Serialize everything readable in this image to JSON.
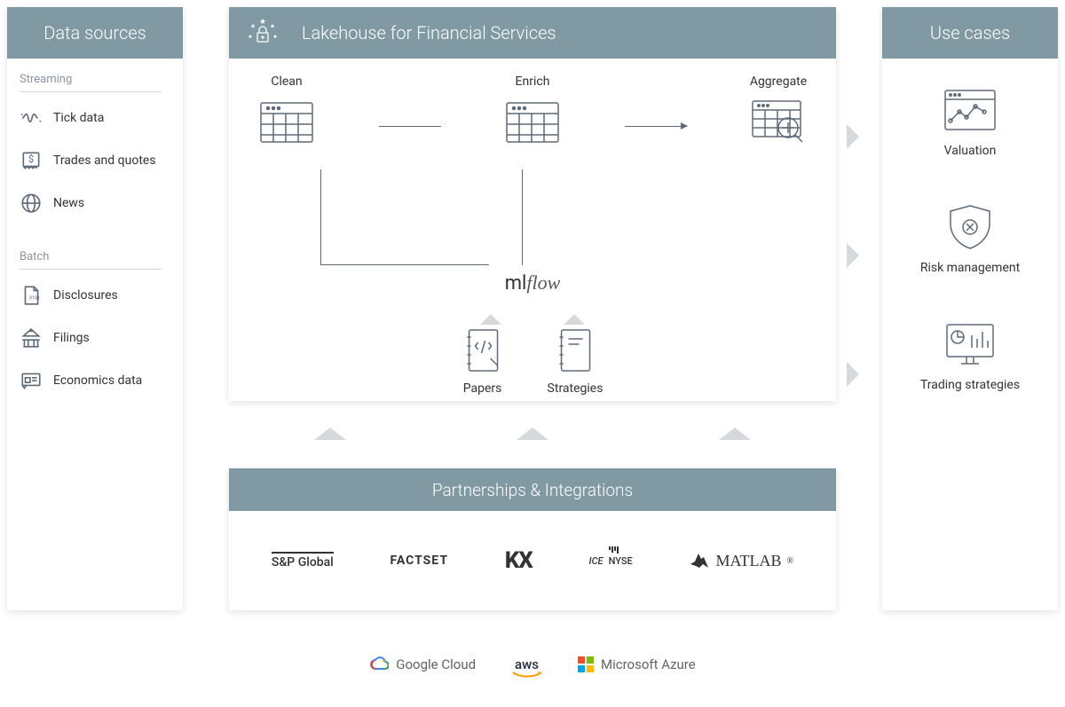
{
  "data_sources": {
    "title": "Data sources",
    "streaming": {
      "title": "Streaming",
      "items": [
        "Tick data",
        "Trades and quotes",
        "News"
      ]
    },
    "batch": {
      "title": "Batch",
      "items": [
        "Disclosures",
        "Filings",
        "Economics data"
      ]
    }
  },
  "lakehouse": {
    "title": "Lakehouse for Financial Services",
    "stages": [
      "Clean",
      "Enrich",
      "Aggregate"
    ],
    "orchestrator_a": "ml",
    "orchestrator_b": "flow",
    "docs": [
      "Papers",
      "Strategies"
    ]
  },
  "partnerships": {
    "title": "Partnerships & Integrations",
    "logos": [
      "S&P Global",
      "FACTSET",
      "KX",
      "ICE",
      "NYSE",
      "MATLAB"
    ]
  },
  "use_cases": {
    "title": "Use cases",
    "items": [
      "Valuation",
      "Risk management",
      "Trading strategies"
    ]
  },
  "clouds": [
    "Google Cloud",
    "aws",
    "Microsoft Azure"
  ]
}
